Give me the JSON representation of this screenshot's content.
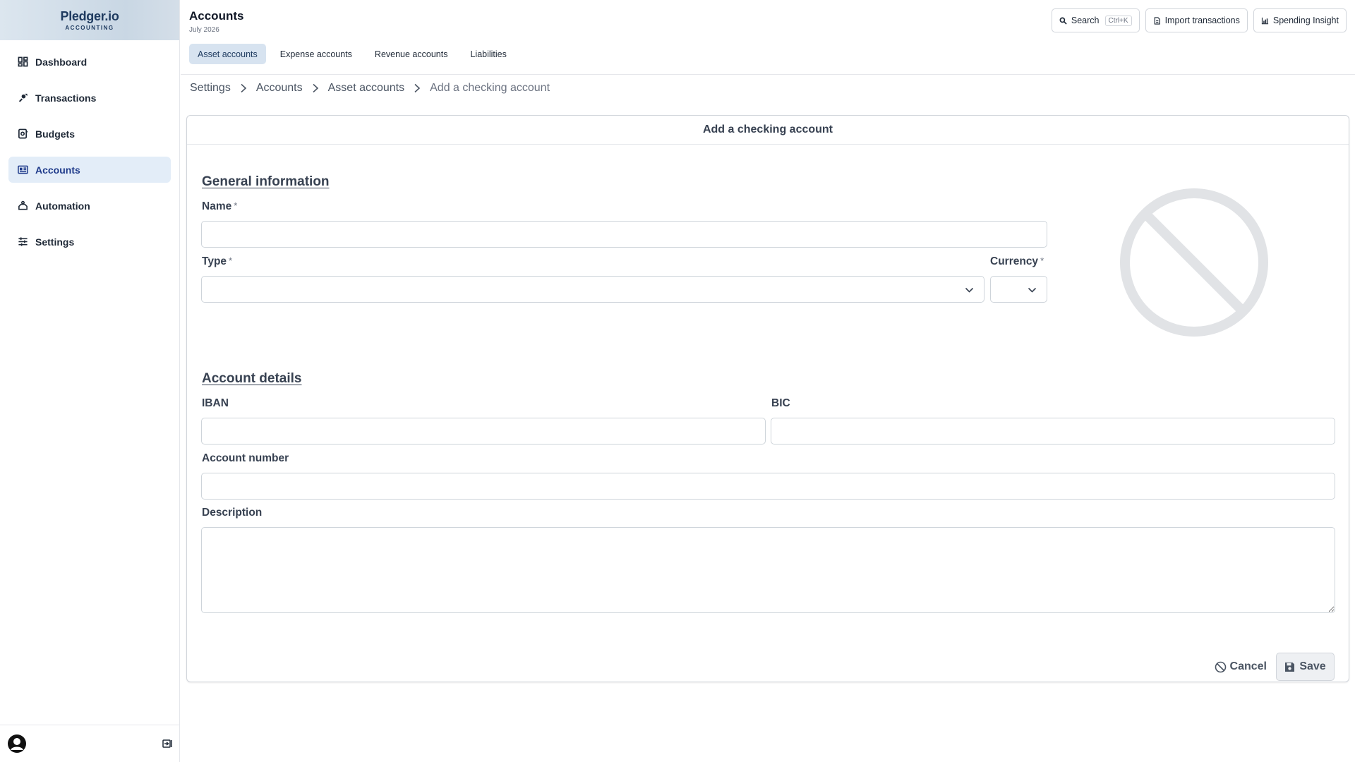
{
  "brand": {
    "name": "Pledger.io",
    "tagline": "ACCOUNTING"
  },
  "sidebar": {
    "items": [
      {
        "label": "Dashboard",
        "icon": "dashboard-icon"
      },
      {
        "label": "Transactions",
        "icon": "transactions-icon"
      },
      {
        "label": "Budgets",
        "icon": "budgets-icon"
      },
      {
        "label": "Accounts",
        "icon": "accounts-icon",
        "active": true
      },
      {
        "label": "Automation",
        "icon": "automation-icon"
      },
      {
        "label": "Settings",
        "icon": "settings-icon"
      }
    ]
  },
  "header": {
    "title": "Accounts",
    "subtitle": "July 2026",
    "tabs": [
      {
        "label": "Asset accounts",
        "active": true
      },
      {
        "label": "Expense accounts"
      },
      {
        "label": "Revenue accounts"
      },
      {
        "label": "Liabilities"
      }
    ],
    "actions": {
      "search_label": "Search",
      "search_shortcut": "Ctrl+K",
      "import_label": "Import transactions",
      "insight_label": "Spending Insight"
    }
  },
  "breadcrumb": [
    "Settings",
    "Accounts",
    "Asset accounts",
    "Add a checking account"
  ],
  "form": {
    "title": "Add a checking account",
    "general_section": "General information",
    "name_label": "Name",
    "type_label": "Type",
    "currency_label": "Currency",
    "required_marker": "*",
    "details_section": "Account details",
    "iban_label": "IBAN",
    "bic_label": "BIC",
    "account_number_label": "Account number",
    "description_label": "Description",
    "name_value": "",
    "type_value": "",
    "currency_value": "",
    "iban_value": "",
    "bic_value": "",
    "account_number_value": "",
    "description_value": "",
    "cancel_label": "Cancel",
    "save_label": "Save"
  },
  "colors": {
    "active_nav_bg": "#e3edf8",
    "active_tab_bg": "#d7e3f0",
    "brand_text": "#1e3a5f",
    "placeholder_gray": "#e1e3e6"
  }
}
